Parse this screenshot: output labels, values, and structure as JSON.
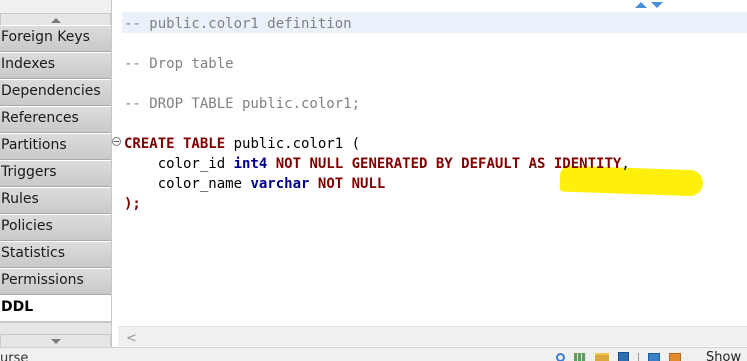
{
  "tabs": [
    {
      "label": "Foreign Keys",
      "active": false
    },
    {
      "label": "Indexes",
      "active": false
    },
    {
      "label": "Dependencies",
      "active": false
    },
    {
      "label": "References",
      "active": false
    },
    {
      "label": "Partitions",
      "active": false
    },
    {
      "label": "Triggers",
      "active": false
    },
    {
      "label": "Rules",
      "active": false
    },
    {
      "label": "Policies",
      "active": false
    },
    {
      "label": "Statistics",
      "active": false
    },
    {
      "label": "Permissions",
      "active": false
    },
    {
      "label": "DDL",
      "active": true
    }
  ],
  "editor": {
    "lines": [
      [
        {
          "t": "-- public.color1 definition",
          "c": "comment"
        }
      ],
      [],
      [
        {
          "t": "-- Drop table",
          "c": "comment"
        }
      ],
      [],
      [
        {
          "t": "-- DROP TABLE public.color1;",
          "c": "comment"
        }
      ],
      [],
      [
        {
          "t": "CREATE TABLE",
          "c": "kw"
        },
        {
          "t": " public.color1 (",
          "c": "id"
        }
      ],
      [
        {
          "t": "    color_id ",
          "c": "id"
        },
        {
          "t": "int4",
          "c": "type"
        },
        {
          "t": " ",
          "c": "id"
        },
        {
          "t": "NOT NULL GENERATED BY DEFAULT AS IDENTITY",
          "c": "kw"
        },
        {
          "t": ",",
          "c": "id"
        }
      ],
      [
        {
          "t": "    color_name ",
          "c": "id"
        },
        {
          "t": "varchar",
          "c": "type"
        },
        {
          "t": " ",
          "c": "id"
        },
        {
          "t": "NOT NULL",
          "c": "kw"
        }
      ],
      [
        {
          "t": ");",
          "c": "kw"
        }
      ]
    ],
    "highlight_color": "#ffee00"
  },
  "hscroll": {
    "left_arrow": "<"
  },
  "status": {
    "partial_text": "urse",
    "show_label": "Show"
  },
  "icons": [
    "scroll-up-icon",
    "scroll-down-icon",
    "nav-up-icon",
    "nav-down-icon",
    "fold-icon",
    "search-icon",
    "grid-icon",
    "folder-icon",
    "save-icon",
    "panel-icon",
    "image-icon"
  ]
}
